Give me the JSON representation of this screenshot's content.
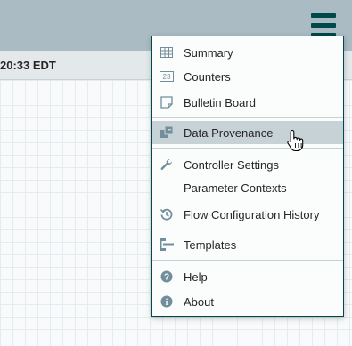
{
  "header": {
    "menu_icon": "hamburger-icon"
  },
  "status": {
    "time": "20:33 EDT",
    "search_icon": "search-icon"
  },
  "menu": {
    "items": [
      {
        "label": "Summary",
        "icon": "table-icon"
      },
      {
        "label": "Counters",
        "icon": "counter-icon"
      },
      {
        "label": "Bulletin Board",
        "icon": "sticky-note-icon"
      },
      {
        "label": "Data Provenance",
        "icon": "provenance-icon",
        "highlighted": true
      },
      {
        "label": "Controller Settings",
        "icon": "wrench-icon"
      },
      {
        "label": "Parameter Contexts",
        "icon": ""
      },
      {
        "label": "Flow Configuration History",
        "icon": "history-icon"
      },
      {
        "label": "Templates",
        "icon": "template-icon"
      },
      {
        "label": "Help",
        "icon": "help-icon"
      },
      {
        "label": "About",
        "icon": "info-icon"
      }
    ]
  },
  "colors": {
    "header_bg": "#aabbc3",
    "menu_border": "#004849",
    "highlight": "#c7d2d7",
    "icon": "#728e9b"
  }
}
